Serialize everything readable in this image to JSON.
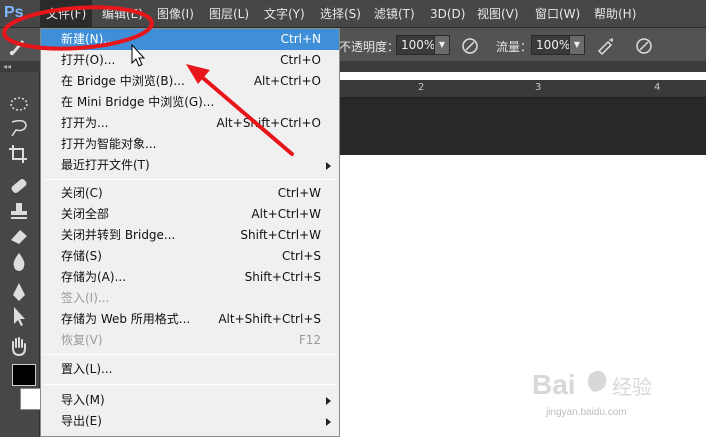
{
  "app": {
    "logo": "Ps"
  },
  "menubar": {
    "items": [
      {
        "label": "文件(F)",
        "active": true
      },
      {
        "label": "编辑(E)"
      },
      {
        "label": "图像(I)"
      },
      {
        "label": "图层(L)"
      },
      {
        "label": "文字(Y)"
      },
      {
        "label": "选择(S)"
      },
      {
        "label": "滤镜(T)"
      },
      {
        "label": "3D(D)"
      },
      {
        "label": "视图(V)"
      },
      {
        "label": "窗口(W)"
      },
      {
        "label": "帮助(H)"
      }
    ]
  },
  "options": {
    "opacity_label": "不透明度：",
    "opacity_value": "100%",
    "flow_label": "流量：",
    "flow_value": "100%"
  },
  "ruler": {
    "ticks": [
      "2",
      "3",
      "4"
    ]
  },
  "file_menu": {
    "items": [
      {
        "label": "新建(N)...",
        "shortcut": "Ctrl+N",
        "highlighted": true
      },
      {
        "label": "打开(O)...",
        "shortcut": "Ctrl+O"
      },
      {
        "label": "在 Bridge 中浏览(B)...",
        "shortcut": "Alt+Ctrl+O"
      },
      {
        "label": "在 Mini Bridge 中浏览(G)...",
        "shortcut": ""
      },
      {
        "label": "打开为...",
        "shortcut": "Alt+Shift+Ctrl+O"
      },
      {
        "label": "打开为智能对象...",
        "shortcut": ""
      },
      {
        "label": "最近打开文件(T)",
        "shortcut": "",
        "submenu": true
      },
      {
        "label": "关闭(C)",
        "shortcut": "Ctrl+W"
      },
      {
        "label": "关闭全部",
        "shortcut": "Alt+Ctrl+W"
      },
      {
        "label": "关闭并转到 Bridge...",
        "shortcut": "Shift+Ctrl+W"
      },
      {
        "label": "存储(S)",
        "shortcut": "Ctrl+S"
      },
      {
        "label": "存储为(A)...",
        "shortcut": "Shift+Ctrl+S"
      },
      {
        "label": "签入(I)...",
        "shortcut": "",
        "disabled": true
      },
      {
        "label": "存储为 Web 所用格式...",
        "shortcut": "Alt+Shift+Ctrl+S"
      },
      {
        "label": "恢复(V)",
        "shortcut": "F12",
        "disabled": true
      },
      {
        "label": "置入(L)...",
        "shortcut": ""
      },
      {
        "label": "导入(M)",
        "shortcut": "",
        "submenu": true
      },
      {
        "label": "导出(E)",
        "shortcut": "",
        "submenu": true
      }
    ]
  },
  "colors": {
    "menu_highlight": "#3f8fd8",
    "annotation_red": "#e8161b"
  },
  "watermark": {
    "brand": "Bai",
    "brand2": "经验",
    "url": "jingyan.baidu.com"
  }
}
